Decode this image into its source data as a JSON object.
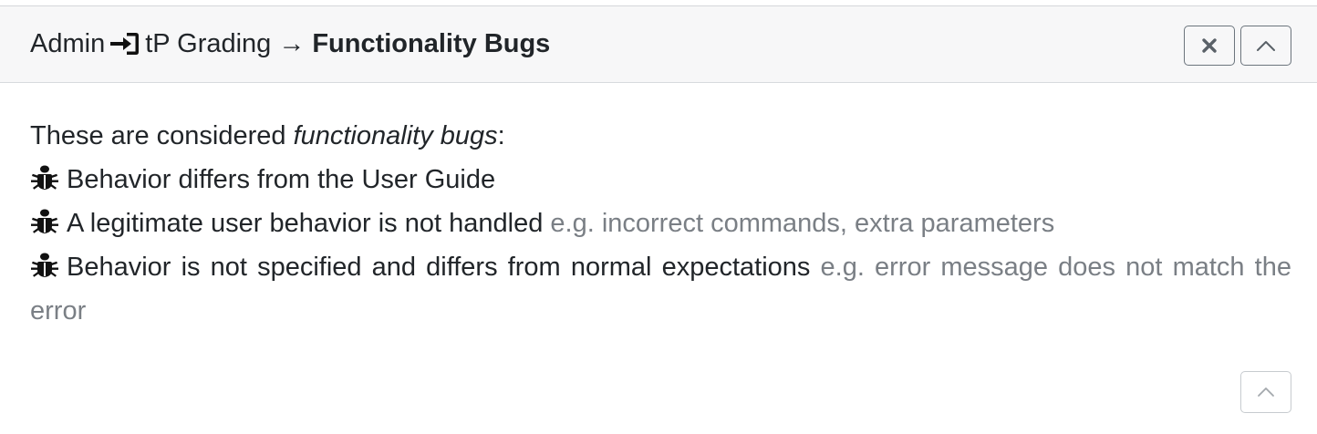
{
  "header": {
    "title_prefix": "Admin",
    "login_icon": "sign-in-icon",
    "title_middle": "tP Grading",
    "arrow": "→",
    "title_bold": "Functionality Bugs",
    "close_icon": "close-icon",
    "collapse_icon": "chevron-up-icon"
  },
  "body": {
    "intro_prefix": "These are considered ",
    "intro_emphasis": "functionality bugs",
    "intro_suffix": ":",
    "bug_icon": "bug-icon",
    "items": [
      {
        "main": "Behavior differs from the User Guide",
        "note": ""
      },
      {
        "main": "A legitimate user behavior is not handled",
        "note": "e.g. incorrect commands, extra parameters"
      },
      {
        "main": "Behavior is not specified and differs from normal expectations",
        "note": "e.g. error message does not match the error"
      }
    ]
  },
  "footer": {
    "collapse_icon": "chevron-up-icon"
  },
  "colors": {
    "header_bg": "#f7f7f8",
    "text": "#212529",
    "muted": "#7a7f85",
    "button_border": "#6c757d"
  }
}
